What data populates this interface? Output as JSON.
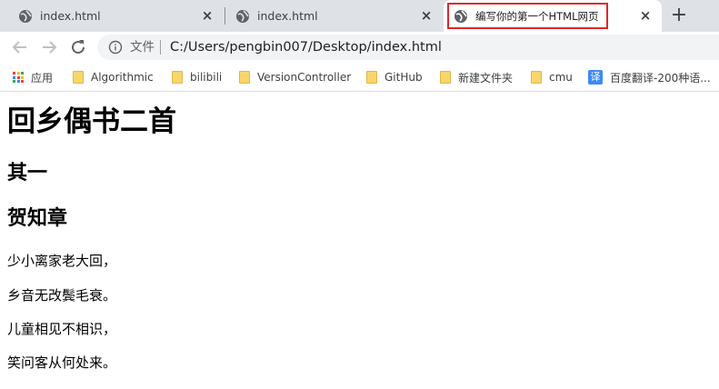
{
  "tabs": [
    {
      "title": "index.html",
      "close": "×"
    },
    {
      "title": "index.html",
      "close": "×"
    },
    {
      "title": "编写你的第一个HTML网页",
      "close": "×"
    }
  ],
  "new_tab": "+",
  "omnibox": {
    "file_label": "文件",
    "url": "C:/Users/pengbin007/Desktop/index.html"
  },
  "bookmarks": [
    {
      "label": "应用",
      "icon": "apps-grid-icon"
    },
    {
      "label": "Algorithmic",
      "icon": "folder-icon"
    },
    {
      "label": "bilibili",
      "icon": "folder-icon"
    },
    {
      "label": "VersionController",
      "icon": "folder-icon"
    },
    {
      "label": "GitHub",
      "icon": "folder-icon"
    },
    {
      "label": "新建文件夹",
      "icon": "folder-icon"
    },
    {
      "label": "cmu",
      "icon": "folder-icon"
    },
    {
      "label": "百度翻译-200种语...",
      "icon": "baidu-translate-icon",
      "icon_text": "译"
    }
  ],
  "page": {
    "title": "回乡偶书二首",
    "subtitle1": "其一",
    "subtitle2": "贺知章",
    "lines": [
      "少小离家老大回，",
      "乡音无改鬓毛衰。",
      "儿童相见不相识，",
      "笑问客从何处来。"
    ]
  },
  "colors": {
    "tabstrip": "#dee1e6",
    "highlight": "#e0262a",
    "omnibox": "#f1f3f4",
    "folder": "#f9d66c",
    "translate": "#3d8af7"
  }
}
